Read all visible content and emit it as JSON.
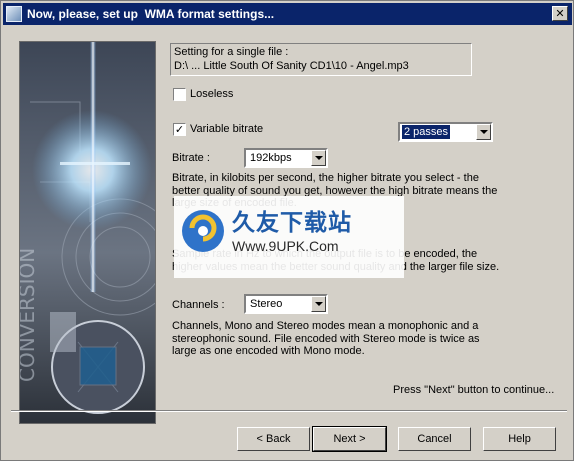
{
  "window": {
    "title": "Now, please, set up  WMA format settings...",
    "close_glyph": "✕"
  },
  "file_info": {
    "label": "Setting for a single file :",
    "path": "D:\\  ...  Little South Of Sanity CD1\\10 - Angel.mp3"
  },
  "options": {
    "loseless_label": "Loseless",
    "loseless_checked": false,
    "vbr_label": "Variable bitrate",
    "vbr_checked": true,
    "passes_value": "2 passes"
  },
  "bitrate": {
    "label": "Bitrate :",
    "value": "192kbps",
    "description": "Bitrate,  in kilobits per second, the higher bitrate you select - the better quality of sound you get, however the high bitrate means the large size of encoded file."
  },
  "quality": {
    "description": "Sample rate in Hz to which the output file is to be encoded, the higher values mean the better sound quality and the larger file size."
  },
  "channels": {
    "label": "Channels :",
    "value": "Stereo",
    "description": "Channels, Mono and Stereo modes mean a monophonic and a stereophonic sound. File encoded with Stereo mode is twice as large as one encoded with Mono mode."
  },
  "hint": "Press \"Next\" button to continue...",
  "buttons": {
    "back": "< Back",
    "next": "Next >",
    "cancel": "Cancel",
    "help": "Help"
  },
  "watermark": {
    "brand": "久友下载站",
    "url": "Www.9UPK.Com"
  },
  "colors": {
    "titlebar": "#0a246a",
    "face": "#d4d0c8",
    "art_glow": "#9fd8ff"
  }
}
